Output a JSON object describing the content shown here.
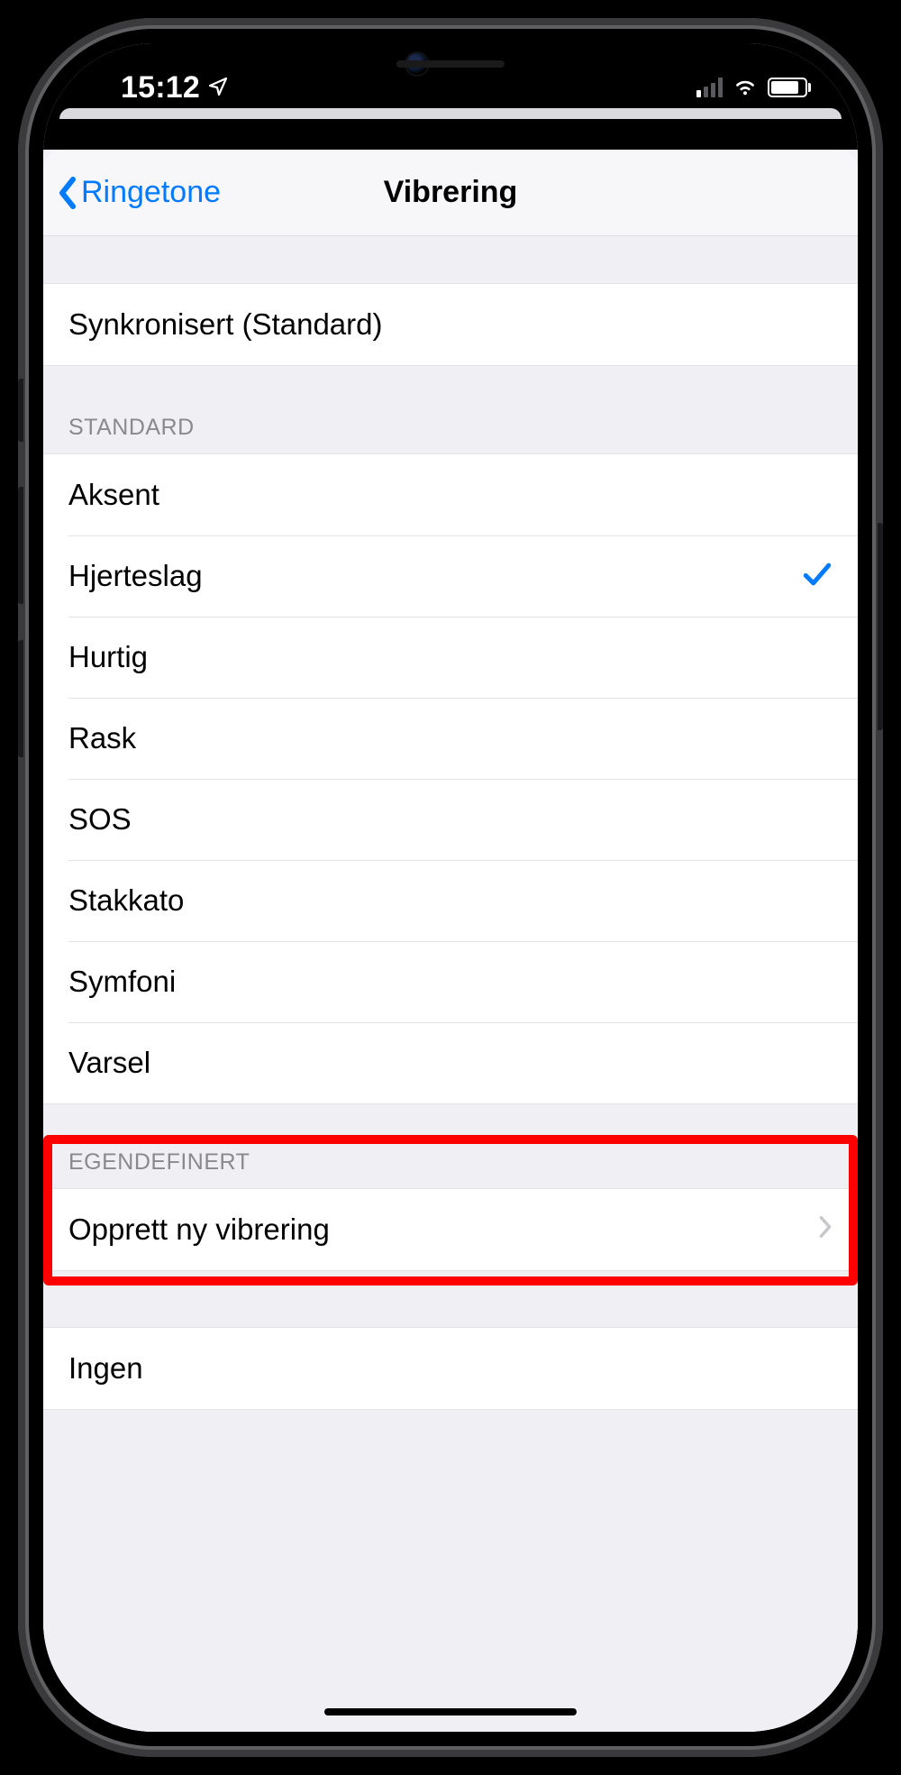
{
  "status": {
    "time": "15:12"
  },
  "nav": {
    "back": "Ringetone",
    "title": "Vibrering"
  },
  "current": {
    "label": "Synkronisert (Standard)"
  },
  "standard": {
    "header": "Standard",
    "items": [
      {
        "label": "Aksent",
        "selected": false
      },
      {
        "label": "Hjerteslag",
        "selected": true
      },
      {
        "label": "Hurtig",
        "selected": false
      },
      {
        "label": "Rask",
        "selected": false
      },
      {
        "label": "SOS",
        "selected": false
      },
      {
        "label": "Stakkato",
        "selected": false
      },
      {
        "label": "Symfoni",
        "selected": false
      },
      {
        "label": "Varsel",
        "selected": false
      }
    ]
  },
  "custom": {
    "header": "Egendefinert",
    "create": "Opprett ny vibrering"
  },
  "none": {
    "label": "Ingen"
  }
}
